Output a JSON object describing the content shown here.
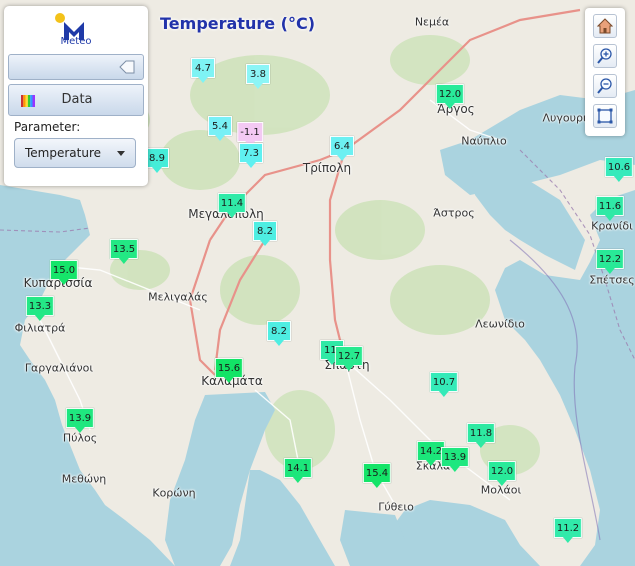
{
  "title": "Temperature (°C)",
  "logo": {
    "text": "Meteo"
  },
  "panel": {
    "data_label": "Data",
    "parameter_label": "Parameter:",
    "parameter_value": "Temperature"
  },
  "controls": {
    "home": "home-icon",
    "zoom_in": "zoom-in-icon",
    "zoom_out": "zoom-out-icon",
    "fit": "fit-extent-icon"
  },
  "places": [
    {
      "name": "Νεμέα"
    },
    {
      "name": "Άργος"
    },
    {
      "name": "Ναύπλιο"
    },
    {
      "name": "Λυγουριό"
    },
    {
      "name": "Τρίπολη"
    },
    {
      "name": "Μεγαλόπολη"
    },
    {
      "name": "Άστρος"
    },
    {
      "name": "Κρανίδι"
    },
    {
      "name": "Σπέτσες"
    },
    {
      "name": "Κυπαρισσία"
    },
    {
      "name": "Μελιγαλάς"
    },
    {
      "name": "Φιλιατρά"
    },
    {
      "name": "Λεωνίδιο"
    },
    {
      "name": "Γαργαλιάνοι"
    },
    {
      "name": "Καλαμάτα"
    },
    {
      "name": "Σπάρτη"
    },
    {
      "name": "Πύλος"
    },
    {
      "name": "Σκάλα"
    },
    {
      "name": "Μεθώνη"
    },
    {
      "name": "Κορώνη"
    },
    {
      "name": "Μολάοι"
    },
    {
      "name": "Γύθειο"
    }
  ],
  "stations": [
    {
      "value": "4.7",
      "color": "#7ef3f4"
    },
    {
      "value": "3.8",
      "color": "#8cf5f6"
    },
    {
      "value": "5.4",
      "color": "#78f0f6"
    },
    {
      "value": "-1.1",
      "color": "#f3c9f3"
    },
    {
      "value": "7.3",
      "color": "#5ff0f0"
    },
    {
      "value": "6.4",
      "color": "#6cf0f2"
    },
    {
      "value": "12.0",
      "color": "#29ea9a"
    },
    {
      "value": "8.9",
      "color": "#45ecd8"
    },
    {
      "value": "11.4",
      "color": "#30eaa8"
    },
    {
      "value": "8.2",
      "color": "#4eeee2"
    },
    {
      "value": "13.5",
      "color": "#23e884"
    },
    {
      "value": "15.0",
      "color": "#16e56a"
    },
    {
      "value": "13.3",
      "color": "#24e886"
    },
    {
      "value": "8.2",
      "color": "#4eeee2"
    },
    {
      "value": "11.",
      "color": "#2ee9a6"
    },
    {
      "value": "12.7",
      "color": "#28e98f"
    },
    {
      "value": "15.6",
      "color": "#12e466"
    },
    {
      "value": "10.7",
      "color": "#34eab8"
    },
    {
      "value": "13.9",
      "color": "#1fe77f"
    },
    {
      "value": "14.2",
      "color": "#1be67a"
    },
    {
      "value": "13.9",
      "color": "#1fe77f"
    },
    {
      "value": "11.8",
      "color": "#2ee9a2"
    },
    {
      "value": "12.0",
      "color": "#29ea9a"
    },
    {
      "value": "14.1",
      "color": "#1ce67b"
    },
    {
      "value": "15.4",
      "color": "#13e468"
    },
    {
      "value": "11.2",
      "color": "#31eaaa"
    },
    {
      "value": "10.6",
      "color": "#36eabb"
    },
    {
      "value": "11.6",
      "color": "#30e9a6"
    },
    {
      "value": "12.2",
      "color": "#29e997"
    }
  ]
}
